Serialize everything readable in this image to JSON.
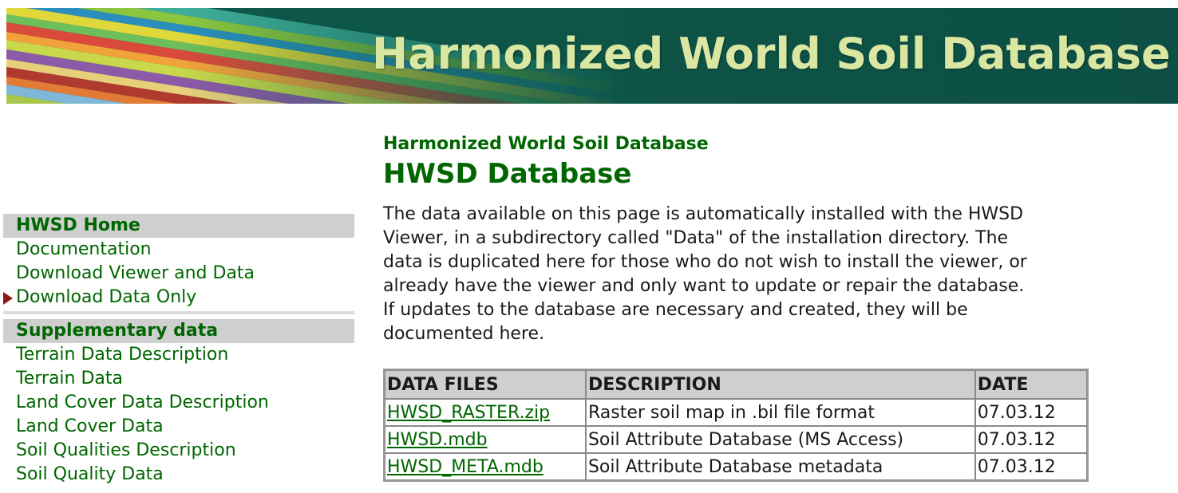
{
  "banner": {
    "title": "Harmonized World Soil Database"
  },
  "colors": {
    "accent_green": "#006600",
    "banner_text": "#d9e7a2",
    "header_gray": "#cfcfcf",
    "current_arrow": "#8b1a1a"
  },
  "sidebar": {
    "heading1": "HWSD Home",
    "items1": [
      {
        "label": "Documentation"
      },
      {
        "label": "Download Viewer and Data"
      },
      {
        "label": "Download Data Only",
        "current": true
      }
    ],
    "heading2": "Supplementary data",
    "items2": [
      {
        "label": "Terrain Data Description"
      },
      {
        "label": "Terrain Data"
      },
      {
        "label": "Land Cover Data Description"
      },
      {
        "label": "Land Cover Data"
      },
      {
        "label": "Soil Qualities Description"
      },
      {
        "label": "Soil Quality Data"
      }
    ]
  },
  "main": {
    "subtitle": "Harmonized World Soil Database",
    "title": "HWSD Database",
    "intro_lines": [
      "The data available on this page is automatically installed with the HWSD",
      "Viewer, in a subdirectory called \"Data\" of the installation directory. The",
      "data is duplicated here for those who do not wish to install the viewer, or",
      "already have the viewer and only want to update or repair the database.",
      "If updates to the database are necessary and created, they will be",
      "documented here."
    ],
    "table": {
      "headers": [
        "DATA FILES",
        "DESCRIPTION",
        "DATE"
      ],
      "rows": [
        {
          "file": "HWSD_RASTER.zip",
          "description": "Raster soil map in .bil file format",
          "date": "07.03.12"
        },
        {
          "file": "HWSD.mdb",
          "description": "Soil Attribute Database (MS Access)",
          "date": "07.03.12"
        },
        {
          "file": "HWSD_META.mdb",
          "description": "Soil Attribute Database metadata",
          "date": "07.03.12"
        }
      ]
    }
  }
}
